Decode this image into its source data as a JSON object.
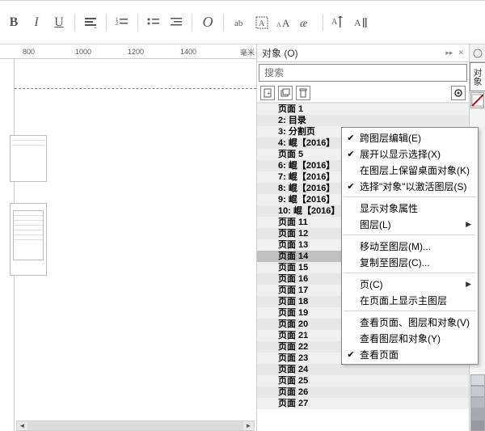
{
  "toolbar": {
    "bold": "B",
    "italic": "I",
    "underline": "U",
    "script": "O"
  },
  "ruler": {
    "t800": "800",
    "t1000": "1000",
    "t1200": "1200",
    "t1400": "1400",
    "unit": "毫米"
  },
  "panel": {
    "title": "对象 (O)",
    "search_placeholder": "搜索"
  },
  "side_tab": {
    "objects": "对象",
    "blank": ""
  },
  "pages": [
    "页面 1",
    "2: 目录",
    "3: 分割页",
    "4: 崐【2016】",
    "页面 5",
    "6: 崐【2016】",
    "7: 崐【2016】",
    "8: 崐【2016】",
    "9: 崐【2016】",
    "10: 崐【2016】",
    "页面 11",
    "页面 12",
    "页面 13",
    "页面 14",
    "页面 15",
    "页面 16",
    "页面 17",
    "页面 18",
    "页面 19",
    "页面 20",
    "页面 21",
    "页面 22",
    "页面 23",
    "页面 24",
    "页面 25",
    "页面 26",
    "页面 27"
  ],
  "selected_page_index": 13,
  "menu": {
    "items": [
      {
        "check": true,
        "label": "跨图层编辑(E)"
      },
      {
        "check": true,
        "label": "展开以显示选择(X)"
      },
      {
        "check": false,
        "label": "在图层上保留桌面对象(K)"
      },
      {
        "check": true,
        "label": "选择\"对象\"以激活图层(S)"
      },
      {
        "sep": true
      },
      {
        "check": false,
        "label": "显示对象属性"
      },
      {
        "check": false,
        "label": "图层(L)",
        "sub": true
      },
      {
        "sep": true
      },
      {
        "check": false,
        "label": "移动至图层(M)..."
      },
      {
        "check": false,
        "label": "复制至图层(C)..."
      },
      {
        "sep": true
      },
      {
        "check": false,
        "label": "页(C)",
        "sub": true
      },
      {
        "check": false,
        "label": "在页面上显示主图层"
      },
      {
        "sep": true
      },
      {
        "check": false,
        "label": "查看页面、图层和对象(V)"
      },
      {
        "check": false,
        "label": "查看图层和对象(Y)"
      },
      {
        "check": true,
        "label": "查看页面"
      }
    ]
  },
  "swatches": [
    "#d8d8e0",
    "#c8c8d0",
    "#b8b8c0",
    "#a8a8b0",
    "#9898a0"
  ]
}
